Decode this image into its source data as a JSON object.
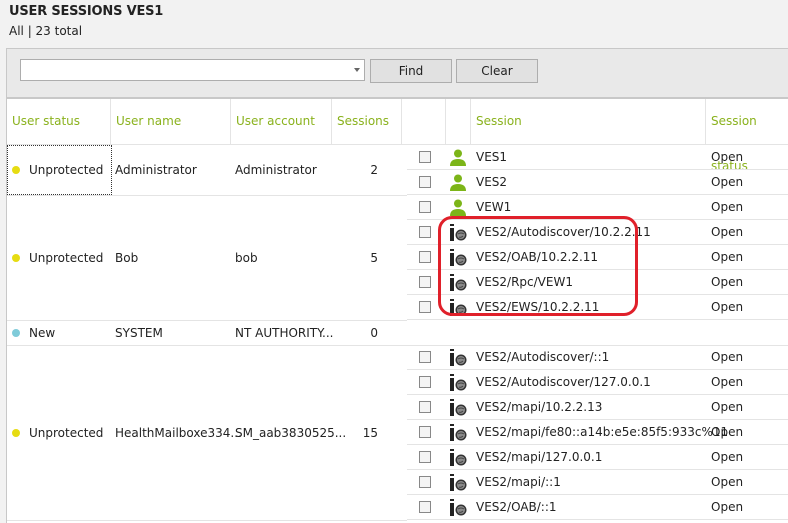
{
  "header": {
    "title": "USER SESSIONS  VES1",
    "subtitle": "All | 23 total"
  },
  "toolbar": {
    "search_value": "",
    "find_label": "Find",
    "clear_label": "Clear"
  },
  "columns": {
    "user_status": "User status",
    "user_name": "User name",
    "user_account": "User account",
    "sessions": "Sessions",
    "check": "",
    "icon": "",
    "session": "Session",
    "session_status": "Session status"
  },
  "colors": {
    "header_text": "#8ab21d",
    "status_unprotected": "#e6dc12",
    "status_new": "#7fcbd9",
    "user_icon": "#7cb518",
    "highlight": "#e0202a"
  },
  "users": [
    {
      "status": "Unprotected",
      "status_color": "#e6dc12",
      "name": "Administrator",
      "account": "Administrator",
      "sessions": "2"
    },
    {
      "status": "Unprotected",
      "status_color": "#e6dc12",
      "name": "Bob",
      "account": "bob",
      "sessions": "5"
    },
    {
      "status": "New",
      "status_color": "#7fcbd9",
      "name": "SYSTEM",
      "account": "NT AUTHORITY...",
      "sessions": "0"
    },
    {
      "status": "Unprotected",
      "status_color": "#e6dc12",
      "name": "HealthMailboxe334...",
      "account": "SM_aab3830525...",
      "sessions": "15"
    }
  ],
  "sessions": [
    {
      "icon": "user-icon",
      "name": "VES1",
      "status": "Open"
    },
    {
      "icon": "user-icon",
      "name": "VES2",
      "status": "Open"
    },
    {
      "icon": "user-icon",
      "name": "VEW1",
      "status": "Open"
    },
    {
      "icon": "web-service-icon",
      "name": "VES2/Autodiscover/10.2.2.11",
      "status": "Open"
    },
    {
      "icon": "web-service-icon",
      "name": "VES2/OAB/10.2.2.11",
      "status": "Open"
    },
    {
      "icon": "web-service-icon",
      "name": "VES2/Rpc/VEW1",
      "status": "Open"
    },
    {
      "icon": "web-service-icon",
      "name": "VES2/EWS/10.2.2.11",
      "status": "Open"
    },
    {
      "icon": "web-service-icon",
      "name": "VES2/Autodiscover/::1",
      "status": "Open"
    },
    {
      "icon": "web-service-icon",
      "name": "VES2/Autodiscover/127.0.0.1",
      "status": "Open"
    },
    {
      "icon": "web-service-icon",
      "name": "VES2/mapi/10.2.2.13",
      "status": "Open"
    },
    {
      "icon": "web-service-icon",
      "name": "VES2/mapi/fe80::a14b:e5e:85f5:933c%11",
      "status": "Open"
    },
    {
      "icon": "web-service-icon",
      "name": "VES2/mapi/127.0.0.1",
      "status": "Open"
    },
    {
      "icon": "web-service-icon",
      "name": "VES2/mapi/::1",
      "status": "Open"
    },
    {
      "icon": "web-service-icon",
      "name": "VES2/OAB/::1",
      "status": "Open"
    }
  ]
}
